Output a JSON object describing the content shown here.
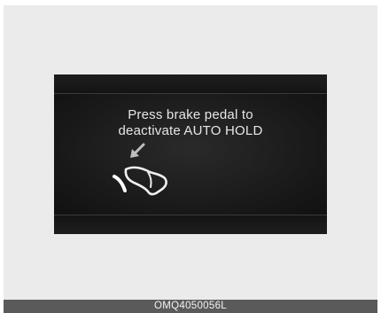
{
  "display": {
    "message_line1": "Press brake pedal to",
    "message_line2": "deactivate AUTO HOLD",
    "illustration_icon": "brake-pedal-foot-icon"
  },
  "caption": {
    "code": "OMQ4050056L"
  },
  "colors": {
    "page_background": "#ebebeb",
    "display_background": "#121212",
    "message_text": "#e6e6e6",
    "caption_background": "#5a5a5a",
    "caption_text": "#f2f2f2"
  }
}
